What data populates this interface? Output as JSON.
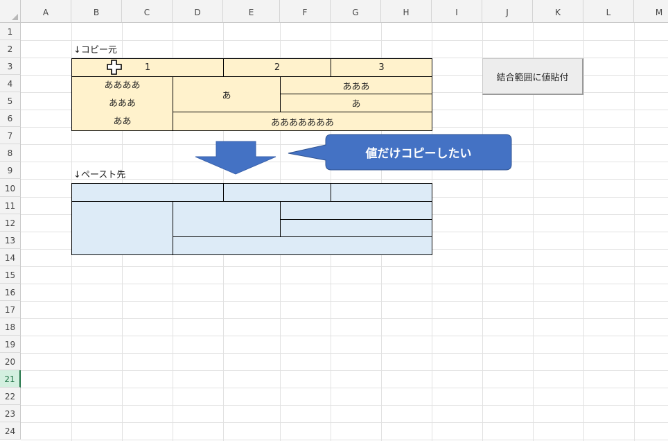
{
  "columns": [
    "A",
    "B",
    "C",
    "D",
    "E",
    "F",
    "G",
    "H",
    "I",
    "J",
    "K",
    "L",
    "M"
  ],
  "rows": [
    "1",
    "2",
    "3",
    "4",
    "5",
    "6",
    "7",
    "8",
    "9",
    "10",
    "11",
    "12",
    "13",
    "14",
    "15",
    "16",
    "17",
    "18",
    "19",
    "20",
    "21",
    "22",
    "23",
    "24"
  ],
  "selected_row": "21",
  "labels": {
    "source": "↓コピー元",
    "destination": "↓ペースト先"
  },
  "source_table": {
    "header": [
      "1",
      "2",
      "3"
    ],
    "left_col": [
      "ああああ",
      "あああ",
      "ああ"
    ],
    "center_merged": "あ",
    "right_r4": "あああ",
    "right_r5": "あ",
    "bottom_merged": "あああああああ"
  },
  "button": {
    "label": "結合範囲に値貼付"
  },
  "callout": {
    "text": "値だけコピーしたい",
    "color": "#4472c4"
  },
  "colors": {
    "source_fill": "#fff2cc",
    "destination_fill": "#ddebf7",
    "arrow_fill": "#4472c4"
  }
}
